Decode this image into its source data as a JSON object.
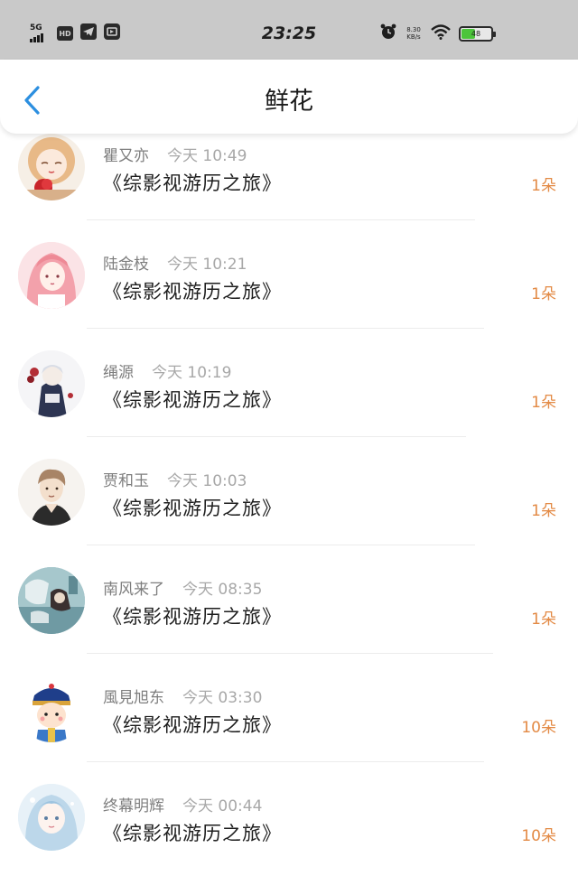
{
  "status_bar": {
    "network": "5G",
    "hd_badge": "HD",
    "time": "23:25",
    "speed_value": "8.30",
    "speed_unit": "KB/s",
    "battery_level": "48",
    "battery_color": "#4cc53b"
  },
  "header": {
    "title": "鲜花",
    "back_icon": "chevron-left-icon",
    "accent": "#2c8fe0"
  },
  "accent_count_color": "#e38a45",
  "items": [
    {
      "name": "瞿又亦",
      "time": "今天 10:49",
      "book": "《综影视游历之旅》",
      "count": "1朵"
    },
    {
      "name": "陆金枝",
      "time": "今天 10:21",
      "book": "《综影视游历之旅》",
      "count": "1朵"
    },
    {
      "name": "绳源",
      "time": "今天 10:19",
      "book": "《综影视游历之旅》",
      "count": "1朵"
    },
    {
      "name": "贾和玉",
      "time": "今天 10:03",
      "book": "《综影视游历之旅》",
      "count": "1朵"
    },
    {
      "name": "南风来了",
      "time": "今天 08:35",
      "book": "《综影视游历之旅》",
      "count": "1朵"
    },
    {
      "name": "風見旭东",
      "time": "今天 03:30",
      "book": "《综影视游历之旅》",
      "count": "10朵"
    },
    {
      "name": "终幕明辉",
      "time": "今天 00:44",
      "book": "《综影视游历之旅》",
      "count": "10朵"
    }
  ]
}
